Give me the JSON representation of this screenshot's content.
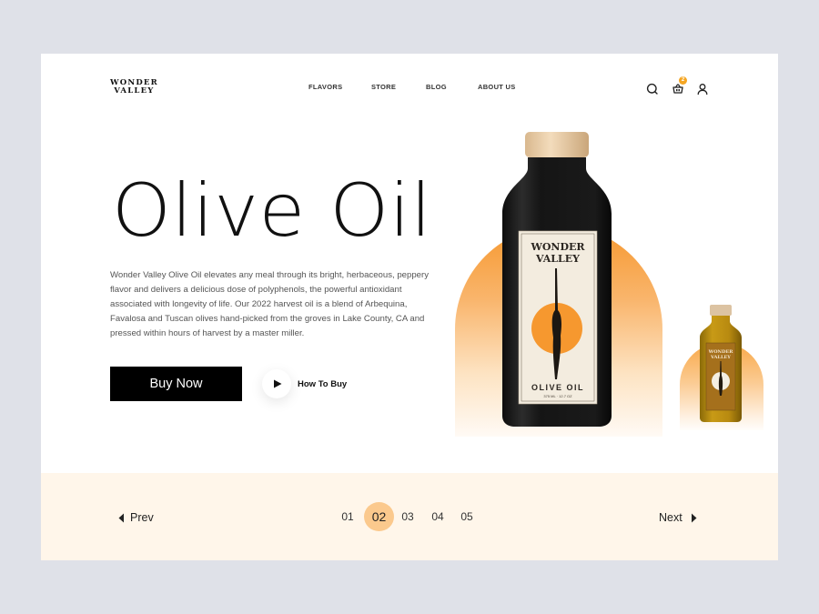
{
  "brand": {
    "line1": "WONDER",
    "line2": "VALLEY"
  },
  "nav": {
    "items": [
      {
        "label": "FLAVORS"
      },
      {
        "label": "STORE"
      },
      {
        "label": "BLOG"
      },
      {
        "label": "ABOUT US"
      }
    ]
  },
  "header_icons": {
    "search": "search-icon",
    "cart": "basket-icon",
    "cart_count": "2",
    "account": "user-icon"
  },
  "hero": {
    "title": "Olive Oil",
    "description": "Wonder Valley Olive Oil elevates any meal through its bright, herbaceous, peppery flavor and delivers a delicious dose of polyphenols, the powerful antioxidant associated with longevity of life. Our 2022 harvest oil is a blend of Arbequina, Favalosa and Tuscan olives hand-picked from the groves in Lake County, CA and pressed within hours of harvest by a master miller.",
    "buy_label": "Buy Now",
    "howto_label": "How To Buy"
  },
  "product": {
    "label_brand_1": "WONDER",
    "label_brand_2": "VALLEY",
    "label_product": "OLIVE OIL",
    "label_volume": "375 ML · 12.7 OZ",
    "accent_color": "#f6982f"
  },
  "pagination": {
    "prev_label": "Prev",
    "next_label": "Next",
    "pages": [
      "01",
      "02",
      "03",
      "04",
      "05"
    ],
    "current": "02",
    "active_color": "#fbc98d"
  }
}
